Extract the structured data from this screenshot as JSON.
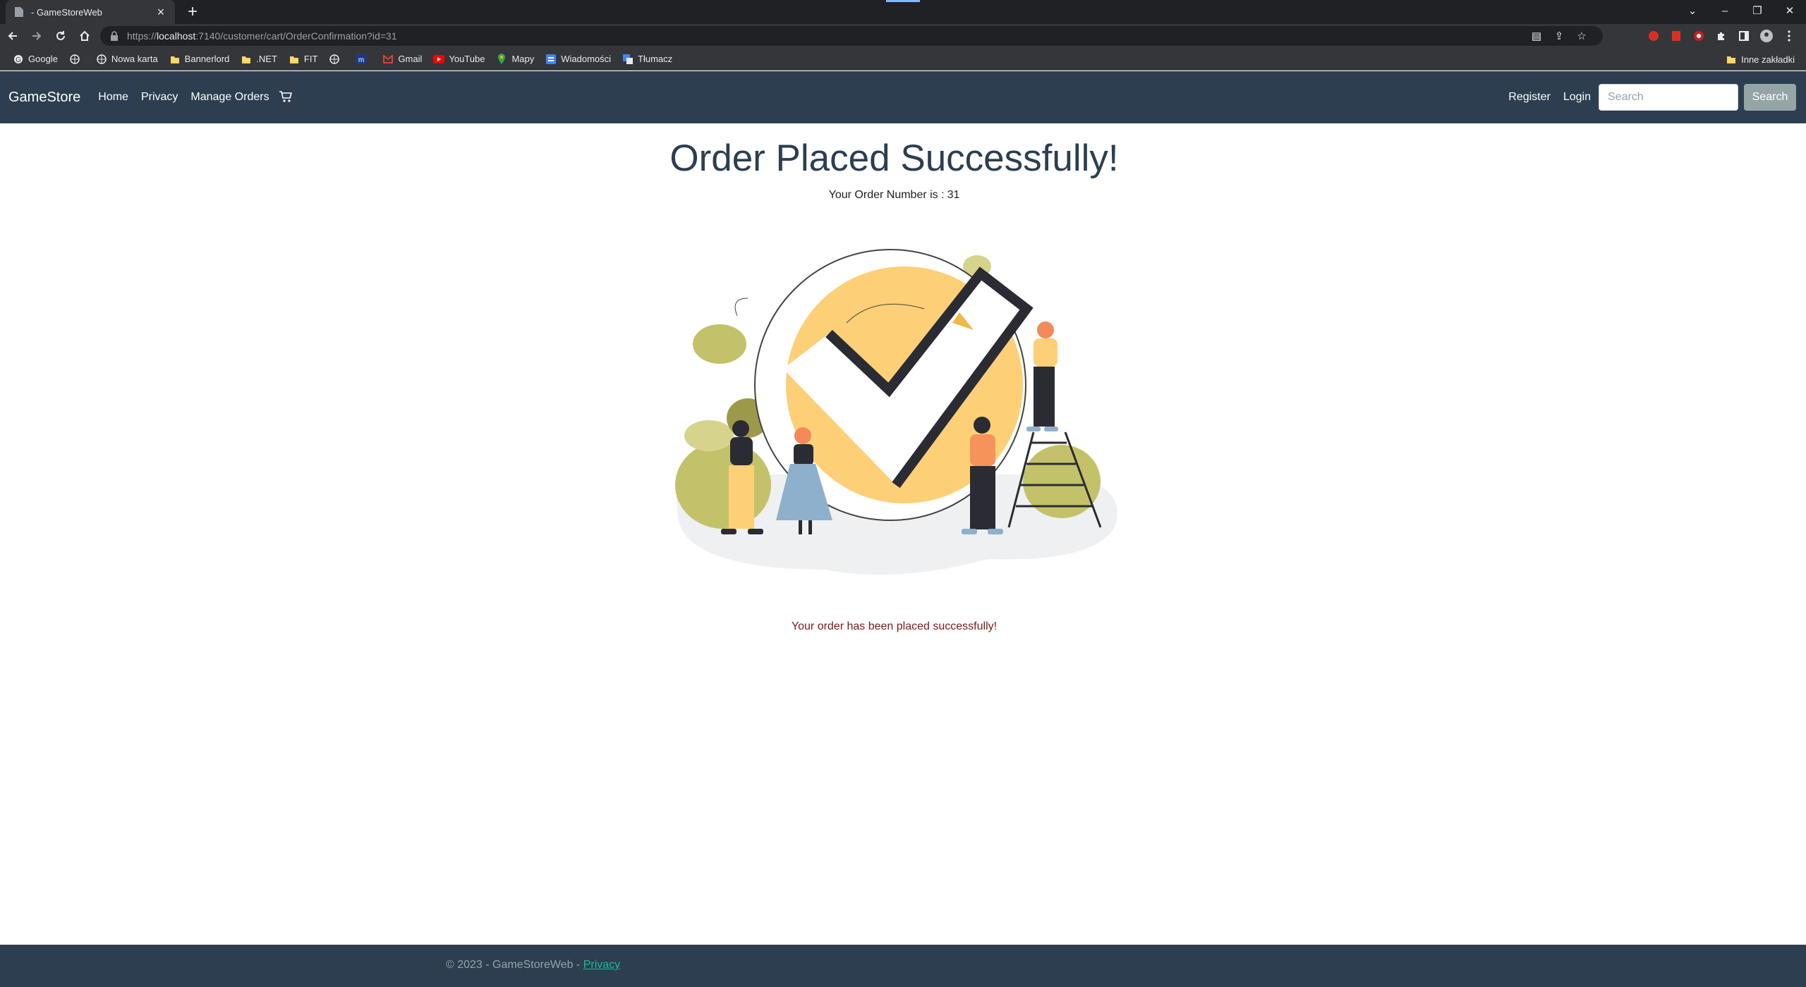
{
  "browser": {
    "tab_title": "- GameStoreWeb",
    "url_prefix": "https://",
    "url_host": "localhost",
    "url_rest": ":7140/customer/cart/OrderConfirmation?id=31",
    "bookmarks": [
      "Google",
      "Nowa karta",
      "Bannerlord",
      ".NET",
      "FIT",
      "Gmail",
      "YouTube",
      "Mapy",
      "Wiadomości",
      "Tłumacz"
    ],
    "other_bookmarks": "Inne zakładki"
  },
  "navbar": {
    "brand": "GameStore",
    "links": [
      "Home",
      "Privacy",
      "Manage Orders"
    ],
    "register": "Register",
    "login": "Login",
    "search_placeholder": "Search",
    "search_button": "Search"
  },
  "main": {
    "title": "Order Placed Successfully!",
    "order_number_label": "Your Order Number is :",
    "order_number": "31",
    "success_message": "Your order has been placed successfully!"
  },
  "footer": {
    "copyright": "© 2023 - GameStoreWeb -",
    "privacy_link": "Privacy"
  },
  "colors": {
    "navbar": "#2c3e50",
    "title": "#2c3e50",
    "success_message": "#7b1a1a",
    "footer_link": "#1abc9c",
    "search_button": "#95a5a6"
  }
}
